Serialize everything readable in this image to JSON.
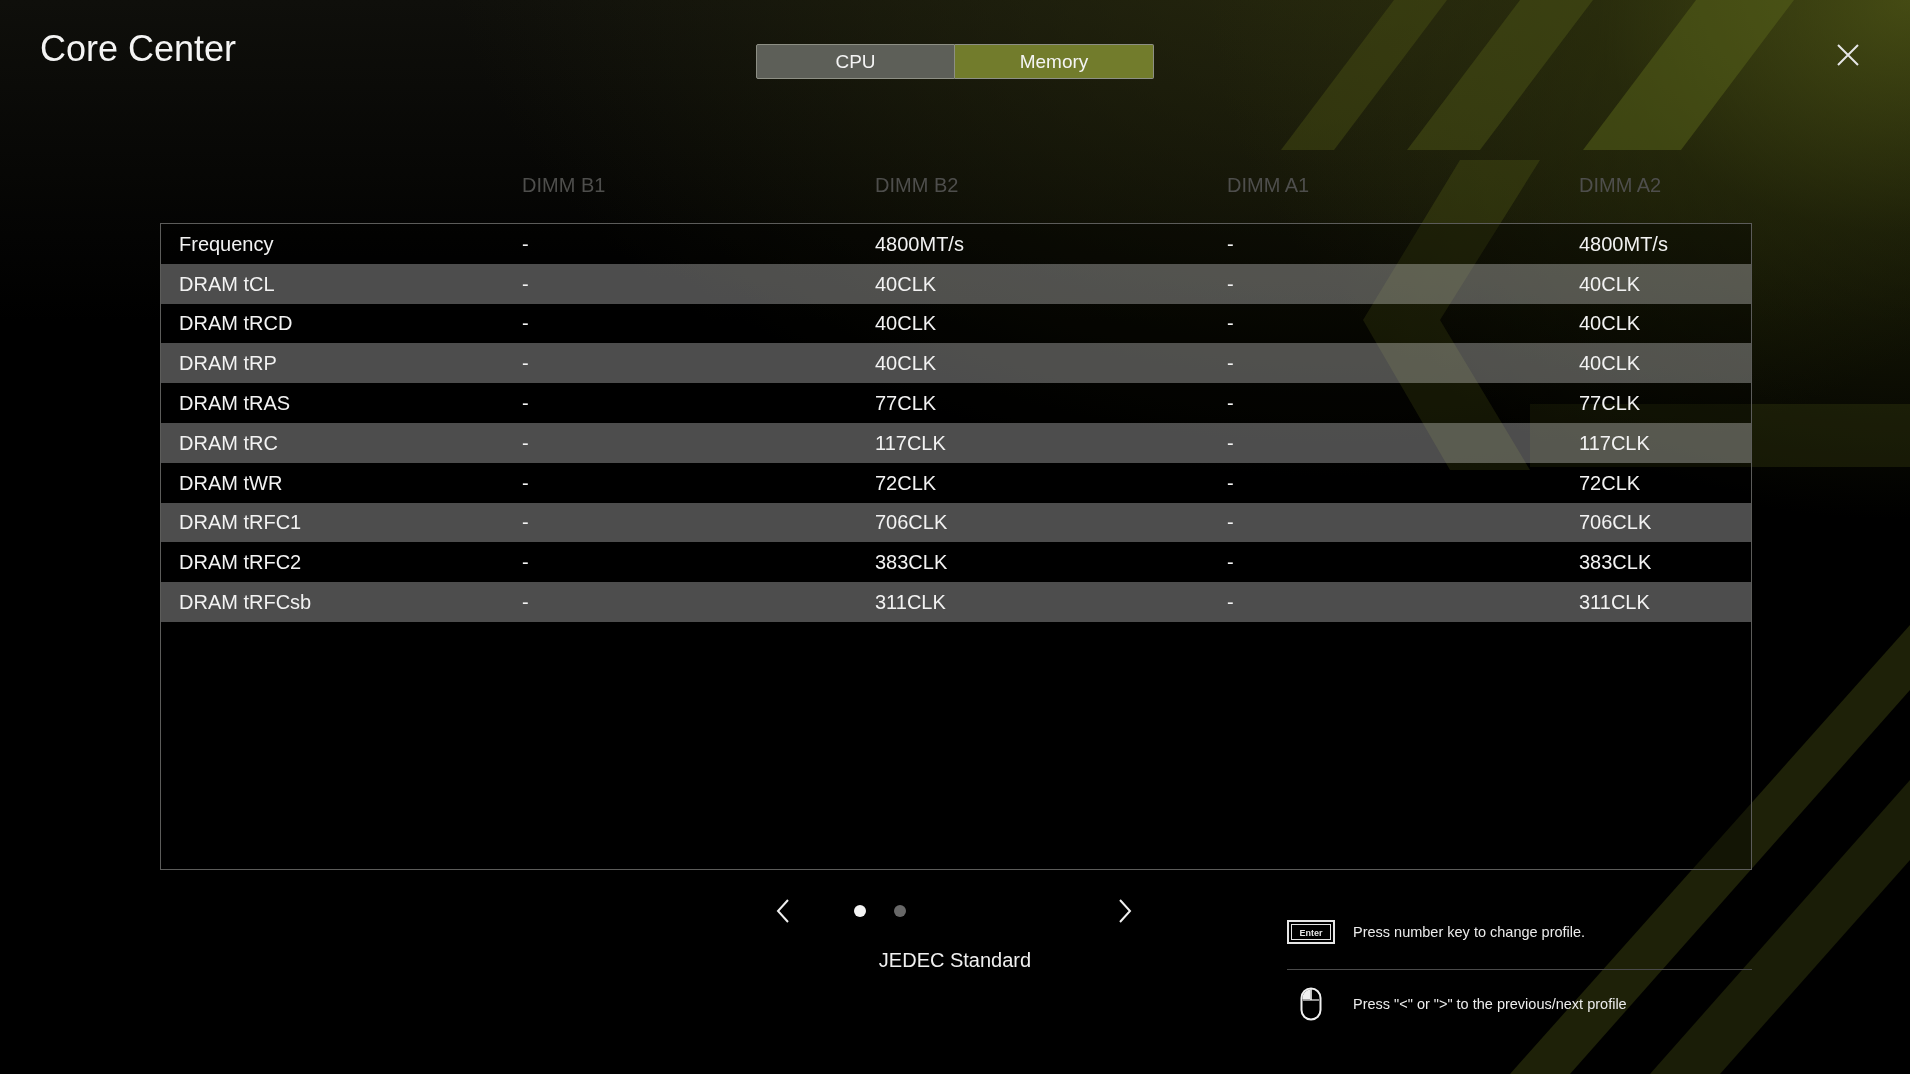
{
  "window": {
    "title": "Core Center"
  },
  "tabs": [
    {
      "label": "CPU",
      "selected": false
    },
    {
      "label": "Memory",
      "selected": true
    }
  ],
  "table": {
    "columns": [
      "DIMM B1",
      "DIMM B2",
      "DIMM A1",
      "DIMM A2"
    ],
    "rows": [
      {
        "label": "Frequency",
        "cells": [
          "-",
          "4800MT/s",
          "-",
          "4800MT/s"
        ]
      },
      {
        "label": "DRAM tCL",
        "cells": [
          "-",
          "40CLK",
          "-",
          "40CLK"
        ]
      },
      {
        "label": "DRAM tRCD",
        "cells": [
          "-",
          "40CLK",
          "-",
          "40CLK"
        ]
      },
      {
        "label": "DRAM tRP",
        "cells": [
          "-",
          "40CLK",
          "-",
          "40CLK"
        ]
      },
      {
        "label": "DRAM tRAS",
        "cells": [
          "-",
          "77CLK",
          "-",
          "77CLK"
        ]
      },
      {
        "label": "DRAM tRC",
        "cells": [
          "-",
          "117CLK",
          "-",
          "117CLK"
        ]
      },
      {
        "label": "DRAM tWR",
        "cells": [
          "-",
          "72CLK",
          "-",
          "72CLK"
        ]
      },
      {
        "label": "DRAM tRFC1",
        "cells": [
          "-",
          "706CLK",
          "-",
          "706CLK"
        ]
      },
      {
        "label": "DRAM tRFC2",
        "cells": [
          "-",
          "383CLK",
          "-",
          "383CLK"
        ]
      },
      {
        "label": "DRAM tRFCsb",
        "cells": [
          "-",
          "311CLK",
          "-",
          "311CLK"
        ]
      }
    ]
  },
  "profile_pager": {
    "pages": [
      {
        "selected": true
      },
      {
        "selected": false
      }
    ],
    "profile_name": "JEDEC Standard"
  },
  "hints": [
    {
      "kind": "keyboard",
      "key_label": "Enter",
      "text": "Press number key to change profile."
    },
    {
      "kind": "mouse",
      "text": "Press \"<\" or \">\" to the previous/next profile"
    }
  ]
}
